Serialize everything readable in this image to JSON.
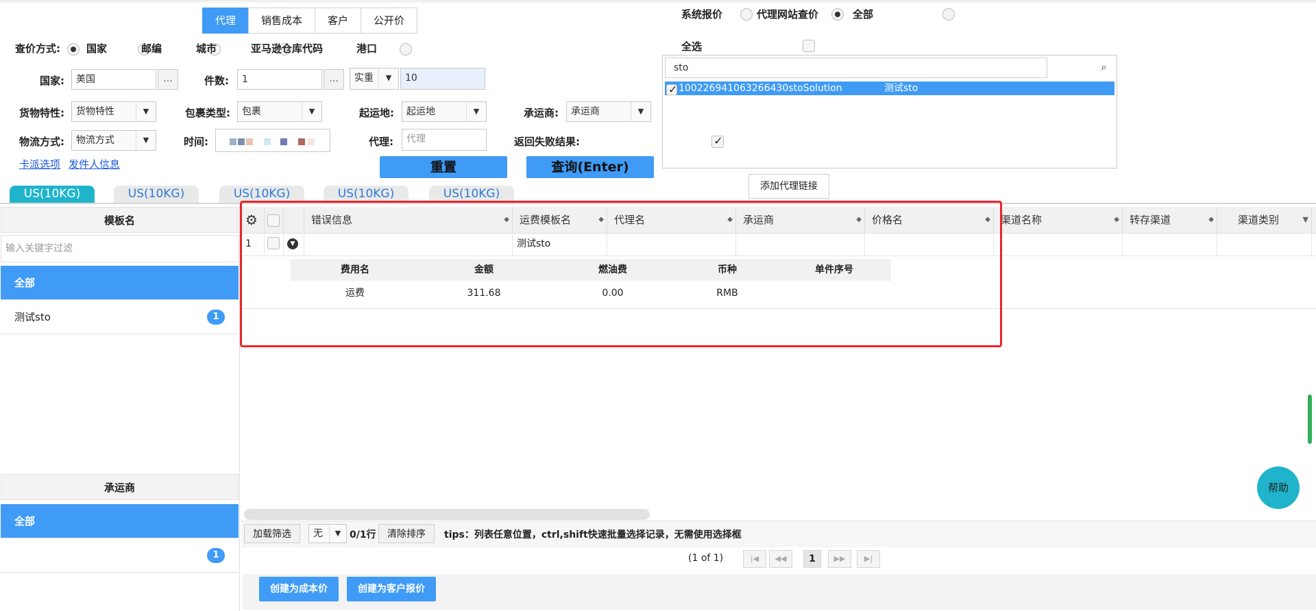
{
  "top_tabs": [
    "代理",
    "销售成本",
    "客户",
    "公开价"
  ],
  "query_mode": {
    "label": "查价方式:",
    "options": [
      "国家",
      "邮编",
      "城市",
      "亚马逊仓库代码",
      "港口"
    ]
  },
  "source_options": [
    "系统报价",
    "代理网站查价",
    "全部"
  ],
  "form": {
    "country_label": "国家:",
    "country_value": "美国",
    "pieces_label": "件数:",
    "pieces_value": "1",
    "weight_type": "实重",
    "weight_value": "10",
    "cargo_label": "货物特性:",
    "cargo_value": "货物特性",
    "package_label": "包裹类型:",
    "package_value": "包裹",
    "origin_label": "起运地:",
    "origin_value": "起运地",
    "carrier_label": "承运商:",
    "carrier_value": "承运商",
    "logistics_label": "物流方式:",
    "logistics_value": "物流方式",
    "time_label": "时间:",
    "agent_label": "代理:",
    "agent_placeholder": "代理",
    "return_fail_label": "返回失败结果:",
    "link_kapai": "卡派选项",
    "link_sender": "发件人信息",
    "reset_label": "重置",
    "query_label": "查询(Enter)",
    "ellipsis": "..."
  },
  "agent_select": {
    "select_all": "全选",
    "search_value": "sto",
    "item_code": "100226941063266430stoSolution",
    "item_name": "测试sto",
    "add_link": "添加代理链接"
  },
  "us_tabs": [
    "US(10KG)",
    "US(10KG)",
    "US(10KG)",
    "US(10KG)",
    "US(10KG)"
  ],
  "left": {
    "template_header": "模板名",
    "filter_placeholder": "输入关键字过滤",
    "all_label": "全部",
    "item_label": "测试sto",
    "item_count": "1",
    "carrier_header": "承运商",
    "carrier_all": "全部",
    "carrier_count": "1"
  },
  "grid": {
    "columns": [
      "错误信息",
      "运费模板名",
      "代理名",
      "承运商",
      "价格名",
      "渠道名称",
      "转存渠道",
      "渠道类别"
    ],
    "row_index": "1",
    "row_template": "测试sto",
    "sub_columns": [
      "费用名",
      "金额",
      "燃油费",
      "币种",
      "单件序号"
    ],
    "sub_row": [
      "运费",
      "311.68",
      "0.00",
      "RMB",
      ""
    ]
  },
  "footer": {
    "load_filter": "加载筛选",
    "none_option": "无",
    "row_count": "0/1行",
    "clear_sort": "清除排序",
    "tips": "tips：列表任意位置，ctrl,shift快速批量选择记录，无需使用选择框",
    "page_info": "(1 of 1)",
    "page_num": "1",
    "create_cost": "创建为成本价",
    "create_customer": "创建为客户报价",
    "help": "帮助"
  },
  "colors": {
    "accent": "#3f9bf5",
    "teal": "#1fb4cc",
    "highlight_red": "#e8262b"
  }
}
